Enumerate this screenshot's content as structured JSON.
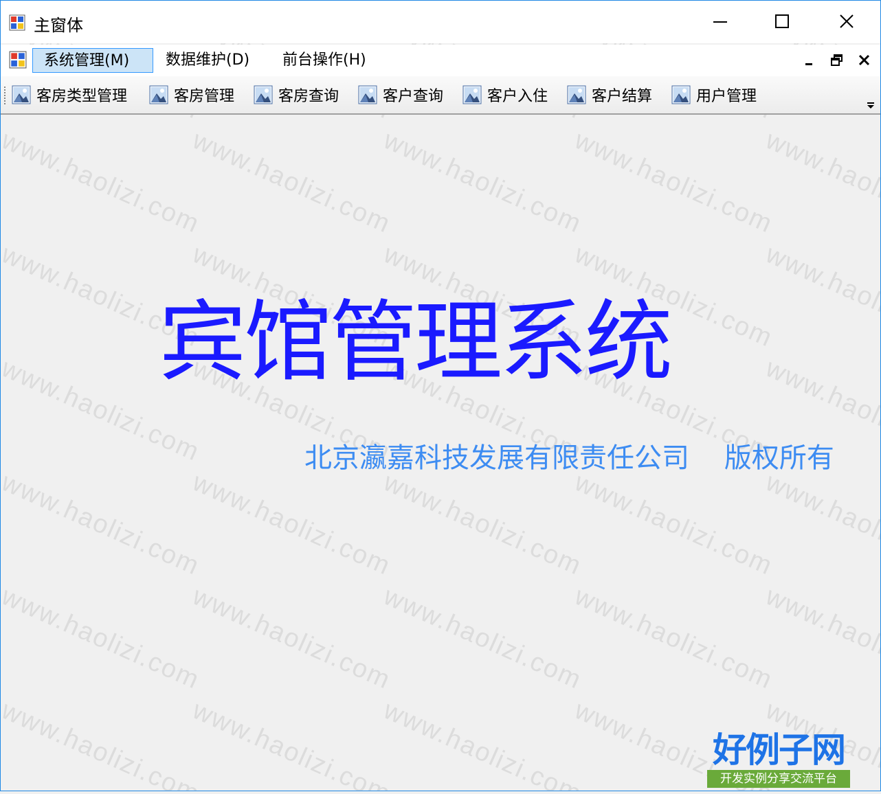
{
  "window": {
    "title": "主窗体",
    "controls": {
      "minimize": "minimize-icon",
      "maximize": "maximize-icon",
      "close": "close-icon"
    }
  },
  "menu": {
    "items": [
      {
        "label": "系统管理(M)",
        "active": true
      },
      {
        "label": "数据维护(D)",
        "active": false
      },
      {
        "label": "前台操作(H)",
        "active": false
      }
    ]
  },
  "toolbar": {
    "items": [
      {
        "label": "客房类型管理",
        "icon": "image-icon"
      },
      {
        "label": "客房管理",
        "icon": "image-icon"
      },
      {
        "label": "客房查询",
        "icon": "image-icon"
      },
      {
        "label": "客户查询",
        "icon": "image-icon"
      },
      {
        "label": "客户入住",
        "icon": "image-icon"
      },
      {
        "label": "客户结算",
        "icon": "image-icon"
      },
      {
        "label": "用户管理",
        "icon": "image-icon"
      }
    ]
  },
  "main": {
    "title": "宾馆管理系统",
    "copyright": "北京瀛嘉科技发展有限责任公司    版权所有"
  },
  "watermark": {
    "text": "www.haolizi.com"
  },
  "logo": {
    "main": "好例子网",
    "sub": "开发实例分享交流平台"
  },
  "colors": {
    "title_text": "#1a1aff",
    "copyright_text": "#3d8cf2",
    "active_menu_bg": "#cce4f7",
    "active_menu_border": "#3399ff",
    "logo_blue": "#1e73e6",
    "logo_green": "#6aaa3a",
    "background": "#f0f0f0"
  }
}
